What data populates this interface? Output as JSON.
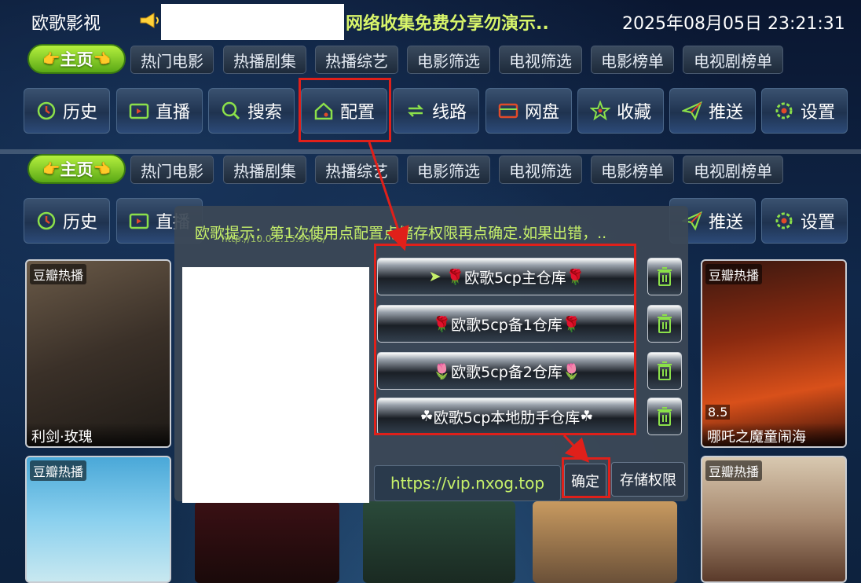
{
  "header": {
    "app_title": "欧歌影视",
    "marquee": "网络收集免费分享勿演示..",
    "clock": "2025年08月05日 23:21:31"
  },
  "home_tab": {
    "label": "主页"
  },
  "tabs": [
    "热门电影",
    "热播剧集",
    "热播综艺",
    "电影筛选",
    "电视筛选",
    "电影榜单",
    "电视剧榜单"
  ],
  "functions": [
    {
      "label": "历史",
      "icon": "history-icon"
    },
    {
      "label": "直播",
      "icon": "tv-icon"
    },
    {
      "label": "搜索",
      "icon": "search-icon"
    },
    {
      "label": "配置",
      "icon": "home-config-icon"
    },
    {
      "label": "线路",
      "icon": "route-icon"
    },
    {
      "label": "网盘",
      "icon": "card-icon"
    },
    {
      "label": "收藏",
      "icon": "star-icon"
    },
    {
      "label": "推送",
      "icon": "send-icon"
    },
    {
      "label": "设置",
      "icon": "gear-icon"
    }
  ],
  "cards": {
    "tag": "豆瓣热播",
    "card1_title": "利剑·玫瑰",
    "card2_title": "哪吒之魔童闹海",
    "card2_score": "8.5"
  },
  "dialog": {
    "hint": "欧歌提示：第1次使用点配置点储存权限再点确定.如果出错，..",
    "server_url": "http://10.0.2.15:9978/",
    "repos": [
      "欧歌5cp主仓库",
      "欧歌5cp备1仓库",
      "欧歌5cp备2仓库",
      "欧歌5cp本地肋手仓库"
    ],
    "url_value": "https://vip.nxog.top",
    "ok_label": "确定",
    "permission_label": "存储权限"
  },
  "colors": {
    "accent_green": "#c6f06a",
    "highlight_red": "#e0201a",
    "home_green": "#7ec822"
  }
}
